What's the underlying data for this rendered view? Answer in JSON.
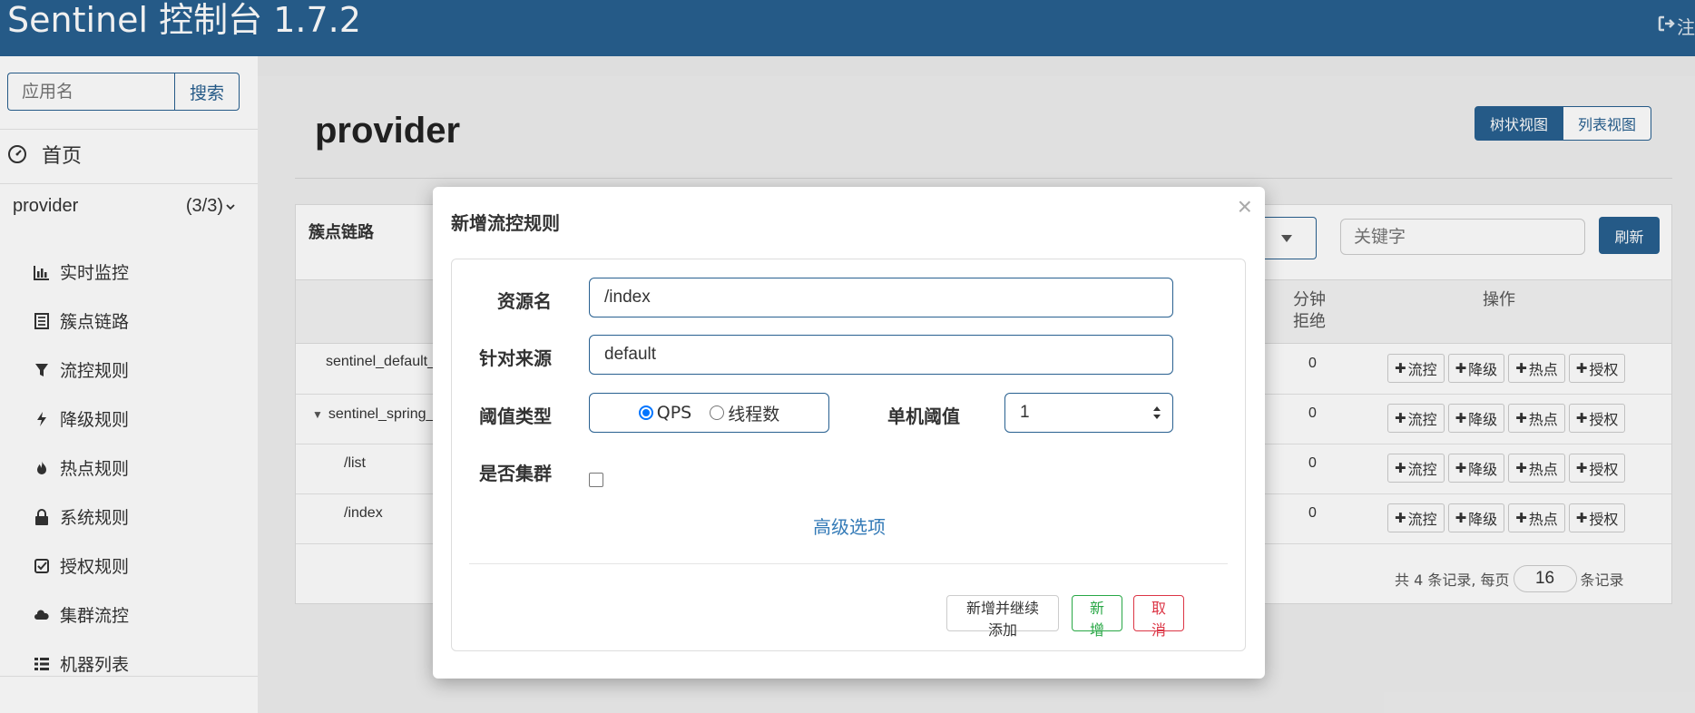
{
  "header": {
    "brand": "Sentinel 控制台 1.7.2",
    "logout_label": "注"
  },
  "sidebar": {
    "search_placeholder": "应用名",
    "search_button": "搜索",
    "home_label": "首页",
    "app": {
      "name": "provider",
      "count": "(3/3)"
    },
    "items": [
      {
        "label": "实时监控",
        "icon": "bar-chart-icon"
      },
      {
        "label": "簇点链路",
        "icon": "list-alt-icon"
      },
      {
        "label": "流控规则",
        "icon": "filter-icon"
      },
      {
        "label": "降级规则",
        "icon": "flash-icon"
      },
      {
        "label": "热点规则",
        "icon": "fire-icon"
      },
      {
        "label": "系统规则",
        "icon": "lock-icon"
      },
      {
        "label": "授权规则",
        "icon": "check-icon"
      },
      {
        "label": "集群流控",
        "icon": "cloud-icon"
      },
      {
        "label": "机器列表",
        "icon": "th-list-icon"
      }
    ]
  },
  "main": {
    "title": "provider",
    "view_tree": "树状视图",
    "view_list": "列表视图",
    "card_title": "簇点链路",
    "keyword_placeholder": "关键字",
    "refresh": "刷新",
    "columns": {
      "reject": "分钟拒绝",
      "ops": "操作"
    },
    "rows": [
      {
        "resource": "sentinel_default_",
        "reject": "0"
      },
      {
        "resource": "sentinel_spring_",
        "reject": "0",
        "expanded": true
      },
      {
        "resource": "/list",
        "reject": "0"
      },
      {
        "resource": "/index",
        "reject": "0"
      }
    ],
    "op_labels": [
      "流控",
      "降级",
      "热点",
      "授权"
    ],
    "pager": {
      "prefix": "共 4 条记录, 每页",
      "page_size": "16",
      "suffix": "条记录"
    }
  },
  "modal": {
    "title": "新增流控规则",
    "close": "×",
    "resource_label": "资源名",
    "resource_value": "/index",
    "origin_label": "针对来源",
    "origin_value": "default",
    "threshold_type_label": "阈值类型",
    "qps_label": "QPS",
    "threads_label": "线程数",
    "threshold_label": "单机阈值",
    "threshold_value": "1",
    "cluster_label": "是否集群",
    "advanced": "高级选项",
    "btn_add_continue": "新增并继续添加",
    "btn_add": "新增",
    "btn_cancel": "取消"
  },
  "colors": {
    "primary": "#286090",
    "success": "#28a745",
    "danger": "#dc3545",
    "link": "#337ab7"
  }
}
